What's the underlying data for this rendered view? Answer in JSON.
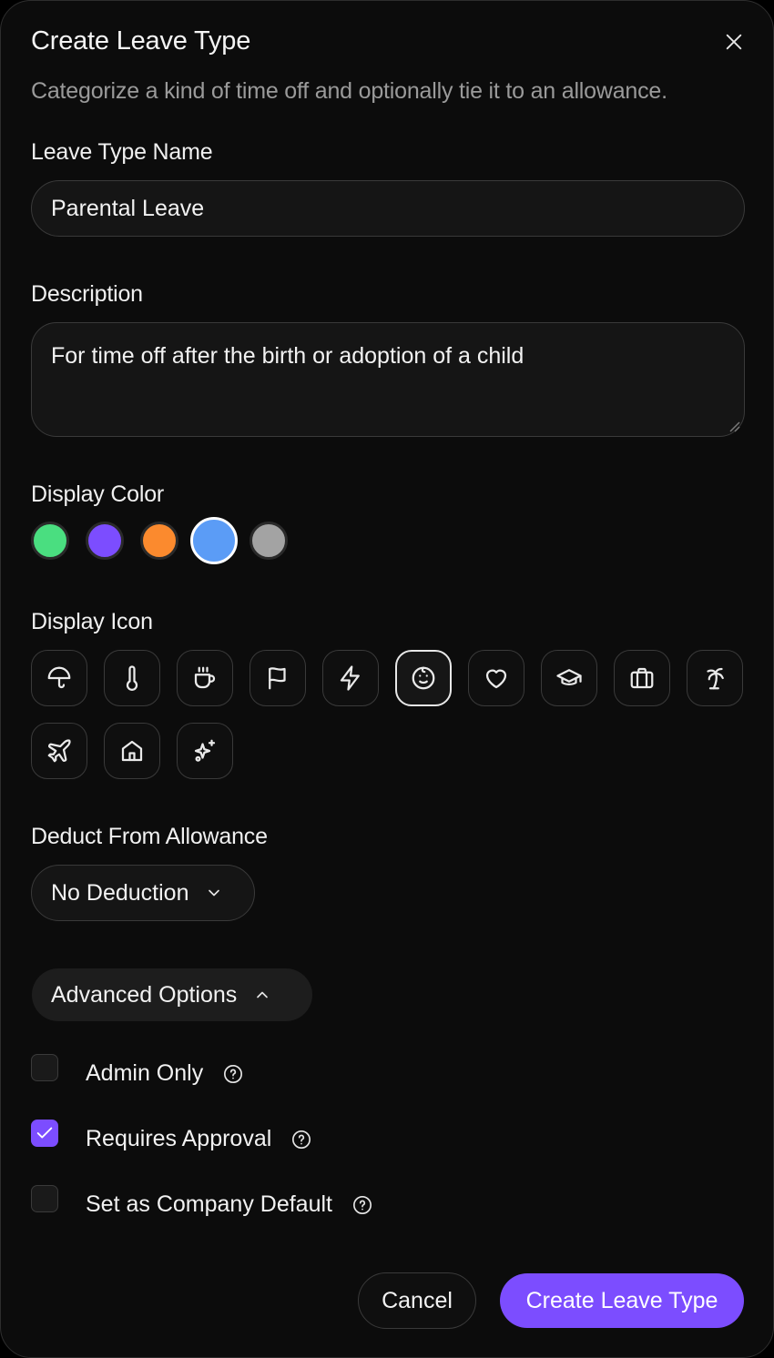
{
  "dialog": {
    "title": "Create Leave Type",
    "subtitle": "Categorize a kind of time off and optionally tie it to an allowance.",
    "close_icon": "close-icon"
  },
  "name_field": {
    "label": "Leave Type Name",
    "value": "Parental Leave"
  },
  "description_field": {
    "label": "Description",
    "value": "For time off after the birth or adoption of a child"
  },
  "display_color": {
    "label": "Display Color",
    "options": [
      "#4ade80",
      "#7c4dff",
      "#fb8a2e",
      "#5b9cf6",
      "#a3a3a3"
    ],
    "selected": "#5b9cf6"
  },
  "display_icon": {
    "label": "Display Icon",
    "options": [
      "umbrella-icon",
      "thermometer-icon",
      "coffee-icon",
      "flag-icon",
      "lightning-icon",
      "baby-icon",
      "heart-icon",
      "graduation-cap-icon",
      "briefcase-icon",
      "palm-tree-icon",
      "plane-icon",
      "home-icon",
      "sparkles-icon"
    ],
    "selected": "baby-icon"
  },
  "deduct": {
    "label": "Deduct From Allowance",
    "value": "No Deduction"
  },
  "advanced": {
    "label": "Advanced Options",
    "expanded": true,
    "options": [
      {
        "label": "Admin Only",
        "checked": false
      },
      {
        "label": "Requires Approval",
        "checked": true
      },
      {
        "label": "Set as Company Default",
        "checked": false
      }
    ]
  },
  "footer": {
    "cancel_label": "Cancel",
    "submit_label": "Create Leave Type"
  },
  "colors": {
    "accent": "#7c4dff",
    "background": "#0c0c0c",
    "border": "#3a3a3a"
  }
}
